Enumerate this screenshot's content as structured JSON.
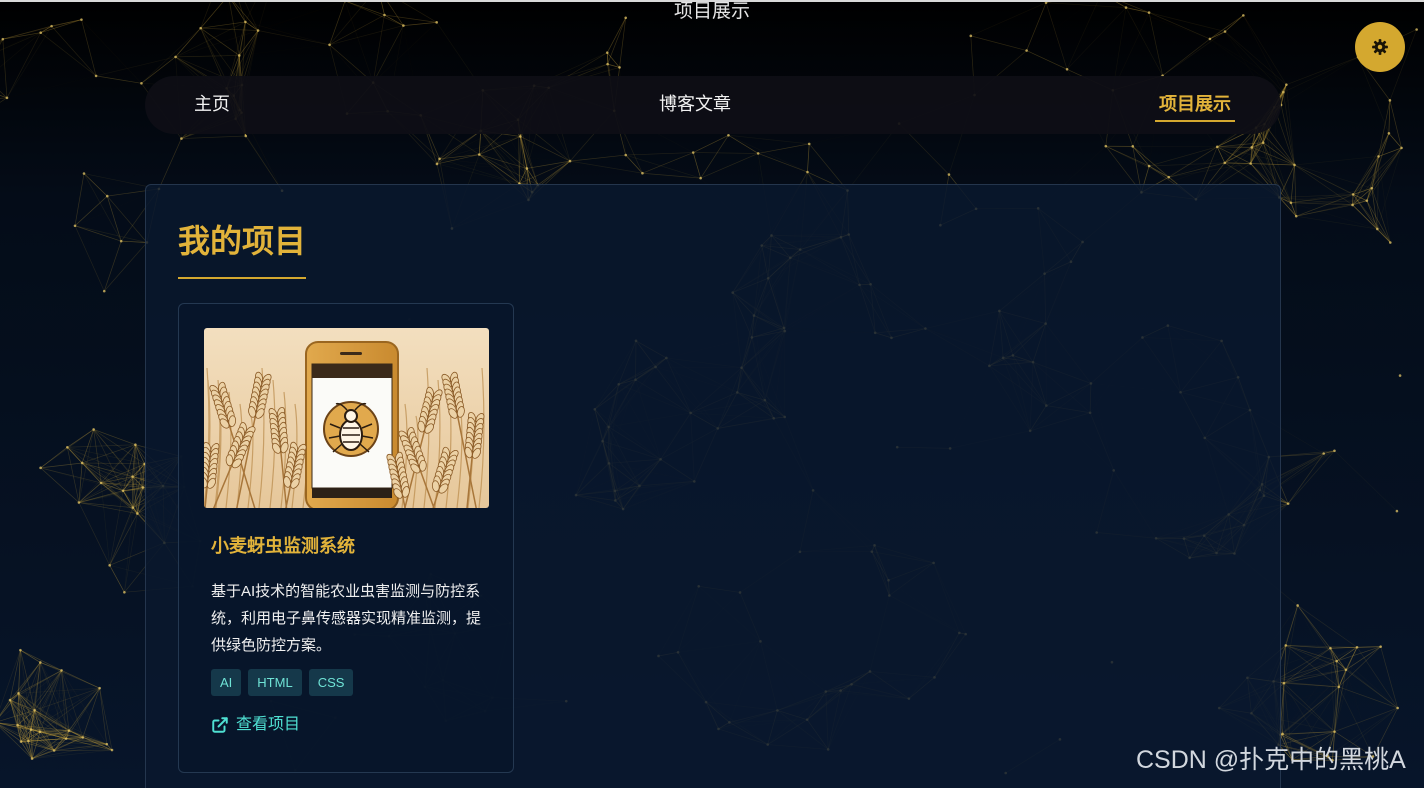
{
  "page": {
    "title": "项目展示"
  },
  "nav": {
    "home": "主页",
    "blog": "博客文章",
    "projects": "项目展示",
    "active": "projects"
  },
  "section": {
    "title": "我的项目"
  },
  "projects": [
    {
      "title": "小麦蚜虫监测系统",
      "description": "基于AI技术的智能农业虫害监测与防控系统，利用电子鼻传感器实现精准监测，提供绿色防控方案。",
      "tags": [
        "AI",
        "HTML",
        "CSS"
      ],
      "link_label": "查看项目"
    }
  ],
  "watermark": "CSDN @扑克中的黑桃A",
  "icons": {
    "theme_toggle": "gear-icon",
    "link": "external-link-icon",
    "project_image": "wheat-field-phone-bug-illustration"
  },
  "colors": {
    "accent_gold": "#d4a82f",
    "title_gold": "#e2b33a",
    "link_teal": "#4fe0d2",
    "tag_bg": "#15384a",
    "background_dark": "#07152a"
  }
}
